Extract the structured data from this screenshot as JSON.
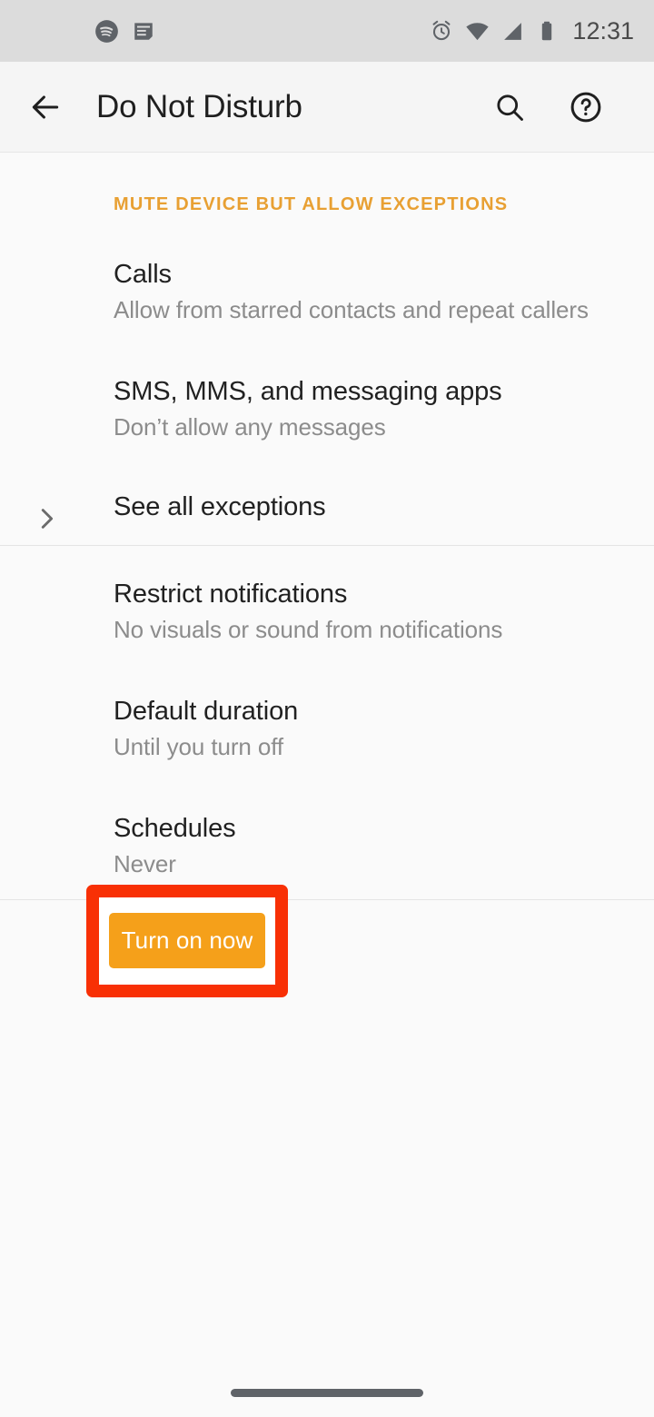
{
  "status_bar": {
    "time": "12:31",
    "left_icons": [
      "spotify-icon",
      "notes-icon"
    ],
    "right_icons": [
      "alarm-icon",
      "wifi-icon",
      "signal-icon",
      "battery-icon"
    ]
  },
  "app_bar": {
    "title": "Do Not Disturb",
    "back_icon": "back-arrow-icon",
    "search_icon": "search-icon",
    "help_icon": "help-icon"
  },
  "colors": {
    "accent_orange": "#e8a033",
    "button_orange": "#f5a01a",
    "highlight_red": "#f83005",
    "background": "#fafafa",
    "status_bar": "#dcdcdc",
    "app_bar": "#f5f5f5"
  },
  "content": {
    "section_header": "MUTE DEVICE BUT ALLOW EXCEPTIONS",
    "rows": [
      {
        "title": "Calls",
        "subtitle": "Allow from starred contacts and repeat callers",
        "chevron": false
      },
      {
        "title": "SMS, MMS, and messaging apps",
        "subtitle": "Don’t allow any messages",
        "chevron": false
      },
      {
        "title": "See all exceptions",
        "subtitle": "",
        "chevron": true
      },
      {
        "title": "Restrict notifications",
        "subtitle": "No visuals or sound from notifications",
        "chevron": false
      },
      {
        "title": "Default duration",
        "subtitle": "Until you turn off",
        "chevron": false
      },
      {
        "title": "Schedules",
        "subtitle": "Never",
        "chevron": false
      }
    ],
    "turn_on_button": "Turn on now"
  },
  "nav_bar": {
    "home_pill": "home-gesture-pill"
  }
}
